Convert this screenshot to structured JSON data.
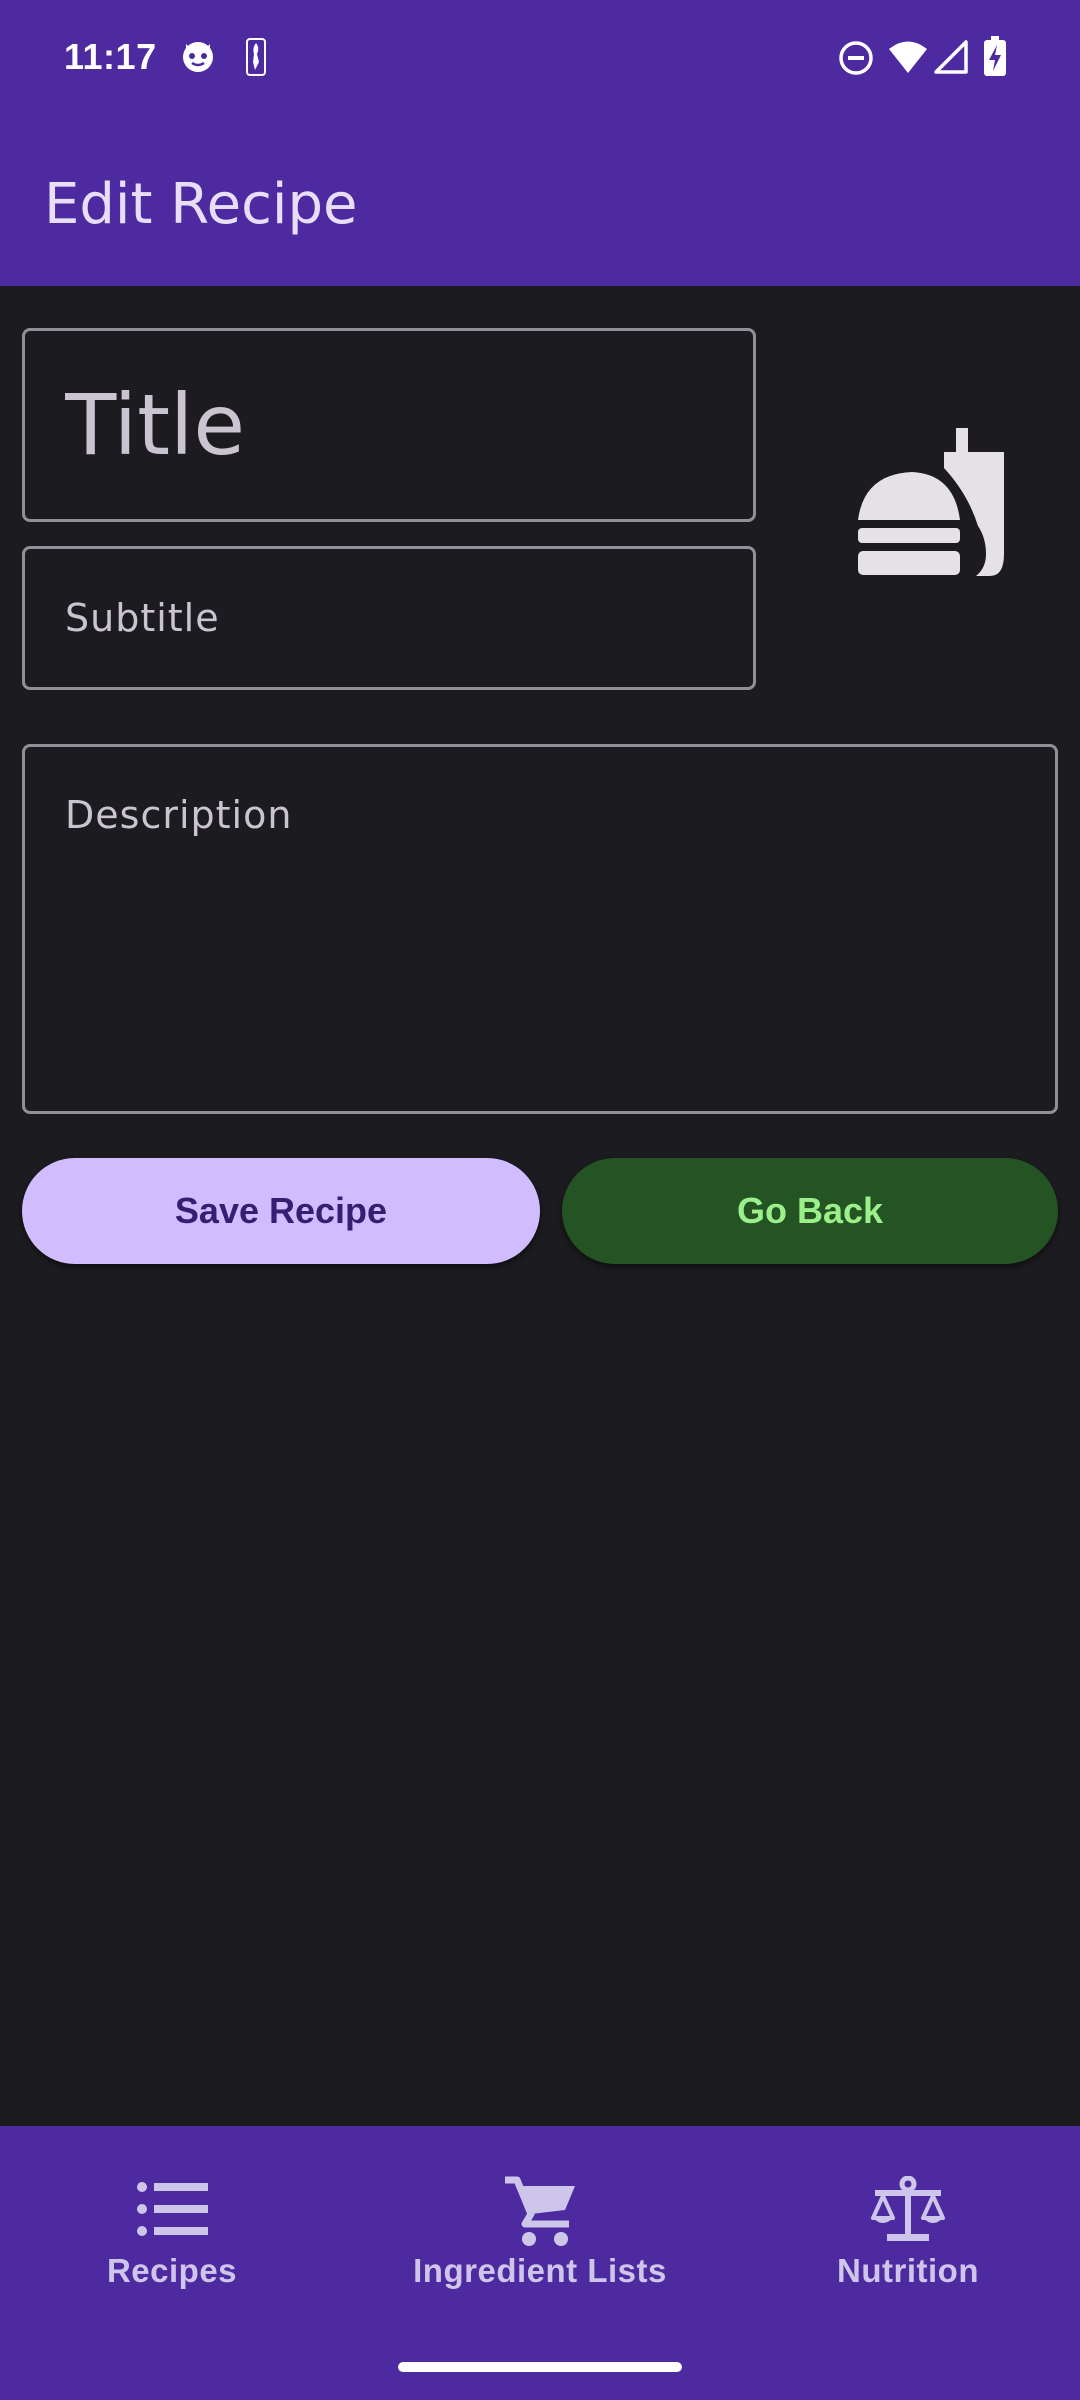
{
  "status_bar": {
    "time": "11:17",
    "icons": [
      "cat-face-icon",
      "nba-logo-icon",
      "do-not-disturb-icon",
      "wifi-icon",
      "cell-signal-icon",
      "battery-charging-icon"
    ]
  },
  "app_bar": {
    "title": "Edit Recipe"
  },
  "form": {
    "title_placeholder": "Title",
    "subtitle_placeholder": "Subtitle",
    "description_placeholder": "Description",
    "recipe_icon": "fastfood-icon"
  },
  "actions": {
    "save_label": "Save Recipe",
    "back_label": "Go Back"
  },
  "bottom_nav": {
    "items": [
      {
        "label": "Recipes",
        "icon": "list-icon"
      },
      {
        "label": "Ingredient Lists",
        "icon": "shopping-cart-icon"
      },
      {
        "label": "Nutrition",
        "icon": "scale-icon"
      }
    ]
  },
  "colors": {
    "primary_bar": "#4e2aa0",
    "background": "#1c1b1f",
    "save_button": "#d0bcff",
    "back_button": "#245324",
    "back_button_text": "#9bf08a"
  }
}
